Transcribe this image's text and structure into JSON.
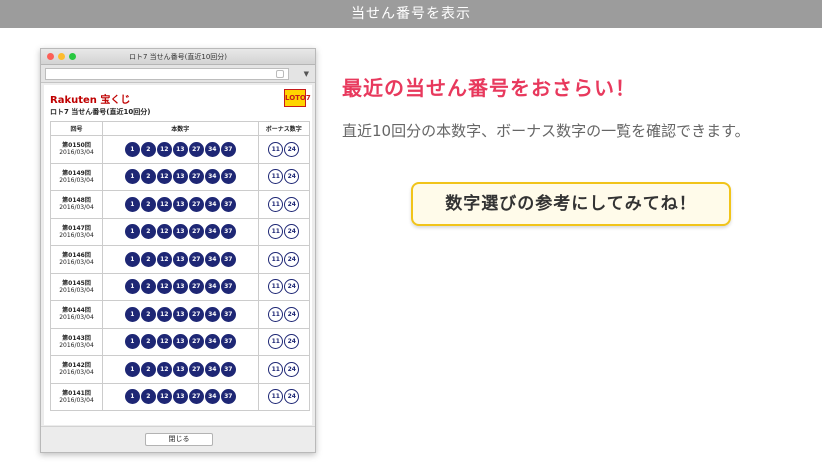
{
  "header": {
    "title": "当せん番号を表示"
  },
  "window": {
    "title": "ロト7 当せん番号(直近10回分)",
    "brand_rakuten": "Rakuten",
    "brand_takarakuji": "宝くじ",
    "logo_text": "LOTO7",
    "subtitle": "ロト7 当せん番号(直近10回分)",
    "columns": [
      "回号",
      "本数字",
      "ボーナス数字"
    ],
    "rows": [
      {
        "draw": "第0150回",
        "date": "2016/03/04",
        "main": [
          "1",
          "2",
          "12",
          "13",
          "27",
          "34",
          "37"
        ],
        "bonus": [
          "11",
          "24"
        ]
      },
      {
        "draw": "第0149回",
        "date": "2016/03/04",
        "main": [
          "1",
          "2",
          "12",
          "13",
          "27",
          "34",
          "37"
        ],
        "bonus": [
          "11",
          "24"
        ]
      },
      {
        "draw": "第0148回",
        "date": "2016/03/04",
        "main": [
          "1",
          "2",
          "12",
          "13",
          "27",
          "34",
          "37"
        ],
        "bonus": [
          "11",
          "24"
        ]
      },
      {
        "draw": "第0147回",
        "date": "2016/03/04",
        "main": [
          "1",
          "2",
          "12",
          "13",
          "27",
          "34",
          "37"
        ],
        "bonus": [
          "11",
          "24"
        ]
      },
      {
        "draw": "第0146回",
        "date": "2016/03/04",
        "main": [
          "1",
          "2",
          "12",
          "13",
          "27",
          "34",
          "37"
        ],
        "bonus": [
          "11",
          "24"
        ]
      },
      {
        "draw": "第0145回",
        "date": "2016/03/04",
        "main": [
          "1",
          "2",
          "12",
          "13",
          "27",
          "34",
          "37"
        ],
        "bonus": [
          "11",
          "24"
        ]
      },
      {
        "draw": "第0144回",
        "date": "2016/03/04",
        "main": [
          "1",
          "2",
          "12",
          "13",
          "27",
          "34",
          "37"
        ],
        "bonus": [
          "11",
          "24"
        ]
      },
      {
        "draw": "第0143回",
        "date": "2016/03/04",
        "main": [
          "1",
          "2",
          "12",
          "13",
          "27",
          "34",
          "37"
        ],
        "bonus": [
          "11",
          "24"
        ]
      },
      {
        "draw": "第0142回",
        "date": "2016/03/04",
        "main": [
          "1",
          "2",
          "12",
          "13",
          "27",
          "34",
          "37"
        ],
        "bonus": [
          "11",
          "24"
        ]
      },
      {
        "draw": "第0141回",
        "date": "2016/03/04",
        "main": [
          "1",
          "2",
          "12",
          "13",
          "27",
          "34",
          "37"
        ],
        "bonus": [
          "11",
          "24"
        ]
      }
    ],
    "close_label": "閉じる"
  },
  "promo": {
    "headline": "最近の当せん番号をおさらい！",
    "description": "直近10回分の本数字、ボーナス数字の一覧を確認できます。",
    "callout": "数字選びの参考にしてみてね！"
  },
  "colors": {
    "accent": "#e8395d",
    "ball": "#1e2775",
    "callout_border": "#f1c41a",
    "brand": "#bf0000"
  }
}
